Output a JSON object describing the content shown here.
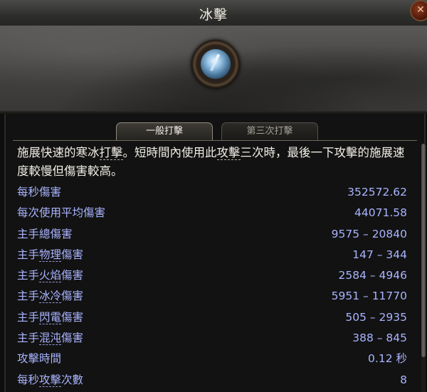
{
  "window": {
    "title": "冰擊",
    "close_symbol": "✕"
  },
  "skill": {
    "icon": "ice-strike-icon"
  },
  "tabs": [
    {
      "label": "一般打擊",
      "active": true
    },
    {
      "label": "第三次打擊",
      "active": false
    }
  ],
  "description": {
    "part1": "施展快速的寒冰",
    "kw1": "打擊",
    "part2": "。短時間內使用此",
    "kw2": "攻擊",
    "part3": "三次時，最後一下攻擊的施展速度較慢但傷害較高。"
  },
  "stats": [
    {
      "label_pre": "每秒傷害",
      "label_kw": "",
      "label_post": "",
      "value": "352572.62"
    },
    {
      "label_pre": "每次使用平均傷害",
      "label_kw": "",
      "label_post": "",
      "value": "44071.58"
    },
    {
      "label_pre": "主手總傷害",
      "label_kw": "",
      "label_post": "",
      "value": "9575 – 20840"
    },
    {
      "label_pre": "主手",
      "label_kw": "物理",
      "label_post": "傷害",
      "value": "147 – 344"
    },
    {
      "label_pre": "主手",
      "label_kw": "火焰",
      "label_post": "傷害",
      "value": "2584 – 4946"
    },
    {
      "label_pre": "主手",
      "label_kw": "冰冷",
      "label_post": "傷害",
      "value": "5951 – 11770"
    },
    {
      "label_pre": "主手",
      "label_kw": "閃電",
      "label_post": "傷害",
      "value": "505 – 2935"
    },
    {
      "label_pre": "主手",
      "label_kw": "混沌",
      "label_post": "傷害",
      "value": "388 – 845"
    },
    {
      "label_pre": "攻擊時間",
      "label_kw": "",
      "label_post": "",
      "value": "0.12 秒"
    },
    {
      "label_pre": "每秒",
      "label_kw": "攻擊",
      "label_post": "次數",
      "value": "8"
    }
  ],
  "colors": {
    "stat_text": "#a9b4ff",
    "description_text": "#f2eee6",
    "title_text": "#f0ece0"
  }
}
